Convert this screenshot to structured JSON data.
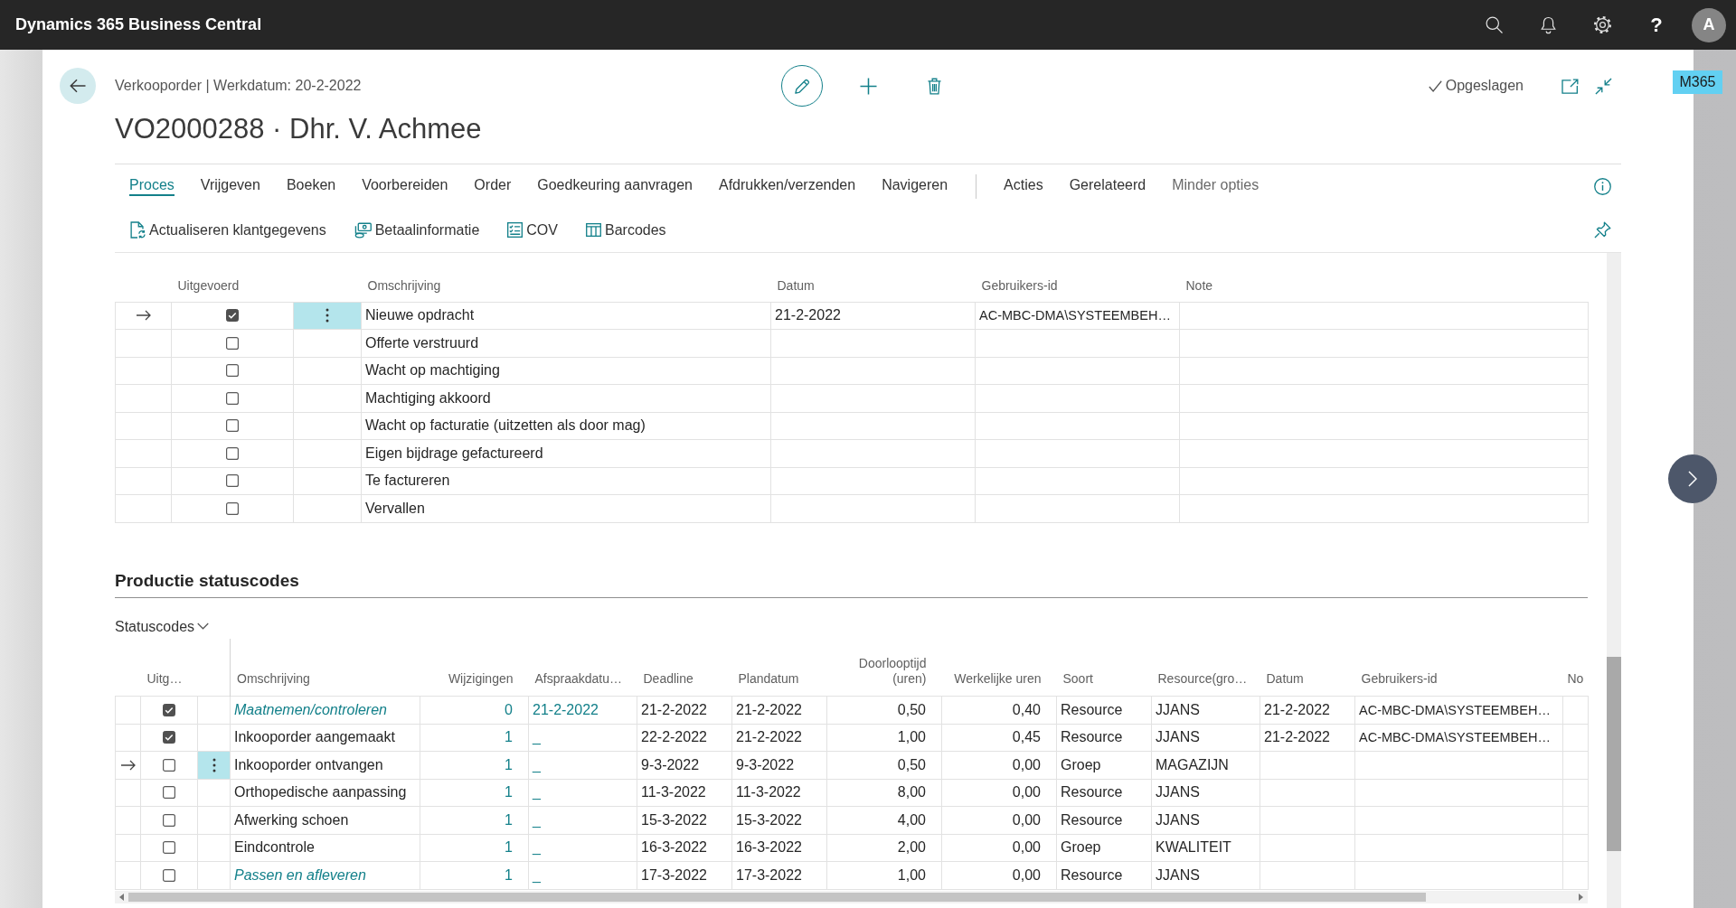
{
  "app_bar": {
    "title": "Dynamics 365 Business Central",
    "help": "?",
    "avatar": "A"
  },
  "environment_badge": "M365",
  "header": {
    "caption": "Verkooporder | Werkdatum: 20-2-2022",
    "title": "VO2000288 · Dhr. V. Achmee",
    "save_status": "Opgeslagen"
  },
  "action_bar": {
    "groups": [
      {
        "tabs": [
          {
            "label": "Proces",
            "selected": true
          },
          {
            "label": "Vrijgeven",
            "selected": false
          },
          {
            "label": "Boeken",
            "selected": false
          },
          {
            "label": "Voorbereiden",
            "selected": false
          },
          {
            "label": "Order",
            "selected": false
          },
          {
            "label": "Goedkeuring aanvragen",
            "selected": false
          },
          {
            "label": "Afdrukken/verzenden",
            "selected": false
          },
          {
            "label": "Navigeren",
            "selected": false
          }
        ]
      },
      {
        "tabs": [
          {
            "label": "Acties",
            "selected": false
          },
          {
            "label": "Gerelateerd",
            "selected": false
          }
        ]
      }
    ],
    "less_options": "Minder opties",
    "actions": [
      {
        "kind": "refresh",
        "label": "Actualiseren klantgegevens"
      },
      {
        "kind": "payment",
        "label": "Betaalinformatie"
      },
      {
        "kind": "checklist",
        "label": "COV"
      },
      {
        "kind": "columns",
        "label": "Barcodes"
      }
    ]
  },
  "process_lines": {
    "columns": [
      "Uitgevoerd",
      "Omschrijving",
      "Datum",
      "Gebruikers-id",
      "Note"
    ],
    "rows": [
      {
        "selected": true,
        "checked": true,
        "description": "Nieuwe opdracht",
        "date": "21-2-2022",
        "user_id": "AC-MBC-DMA\\SYSTEEMBEH…"
      },
      {
        "selected": false,
        "checked": false,
        "description": "Offerte verstruurd"
      },
      {
        "selected": false,
        "checked": false,
        "description": "Wacht op machtiging"
      },
      {
        "selected": false,
        "checked": false,
        "description": "Machtiging akkoord"
      },
      {
        "selected": false,
        "checked": false,
        "description": "Wacht op facturatie (uitzetten als door mag)"
      },
      {
        "selected": false,
        "checked": false,
        "description": "Eigen bijdrage gefactureerd"
      },
      {
        "selected": false,
        "checked": false,
        "description": "Te factureren"
      },
      {
        "selected": false,
        "checked": false,
        "description": "Vervallen"
      }
    ]
  },
  "production_status": {
    "title": "Productie statuscodes",
    "menu_label": "Statuscodes",
    "columns": [
      "Uitg…",
      "Omschrijving",
      "Wijzigingen",
      "Afspraakdatu…",
      "Deadline",
      "Plandatum",
      "Doorlooptijd (uren)",
      "Werkelijke uren",
      "Soort",
      "Resource(gro…",
      "Datum",
      "Gebruikers-id",
      "No"
    ],
    "rows": [
      {
        "selected": false,
        "checked": true,
        "accent": true,
        "description": "Maatnemen/controleren",
        "changes": "0",
        "appointment_date": "21-2-2022",
        "deadline": "21-2-2022",
        "plan_date": "21-2-2022",
        "lead_time": "0,50",
        "actual_hours": "0,40",
        "type": "Resource",
        "resource": "JJANS",
        "date": "21-2-2022",
        "user_id": "AC-MBC-DMA\\SYSTEEMBEH…"
      },
      {
        "selected": false,
        "checked": true,
        "accent": false,
        "description": "Inkooporder aangemaakt",
        "changes": "1",
        "appointment_date": "_",
        "deadline": "22-2-2022",
        "plan_date": "21-2-2022",
        "lead_time": "1,00",
        "actual_hours": "0,45",
        "type": "Resource",
        "resource": "JJANS",
        "date": "21-2-2022",
        "user_id": "AC-MBC-DMA\\SYSTEEMBEH…"
      },
      {
        "selected": true,
        "checked": false,
        "accent": false,
        "description": "Inkooporder ontvangen",
        "changes": "1",
        "appointment_date": "_",
        "deadline": "9-3-2022",
        "plan_date": "9-3-2022",
        "lead_time": "0,50",
        "actual_hours": "0,00",
        "type": "Groep",
        "resource": "MAGAZIJN"
      },
      {
        "selected": false,
        "checked": false,
        "accent": false,
        "description": "Orthopedische aanpassing",
        "changes": "1",
        "appointment_date": "_",
        "deadline": "11-3-2022",
        "plan_date": "11-3-2022",
        "lead_time": "8,00",
        "actual_hours": "0,00",
        "type": "Resource",
        "resource": "JJANS"
      },
      {
        "selected": false,
        "checked": false,
        "accent": false,
        "description": "Afwerking schoen",
        "changes": "1",
        "appointment_date": "_",
        "deadline": "15-3-2022",
        "plan_date": "15-3-2022",
        "lead_time": "4,00",
        "actual_hours": "0,00",
        "type": "Resource",
        "resource": "JJANS"
      },
      {
        "selected": false,
        "checked": false,
        "accent": false,
        "description": "Eindcontrole",
        "changes": "1",
        "appointment_date": "_",
        "deadline": "16-3-2022",
        "plan_date": "16-3-2022",
        "lead_time": "2,00",
        "actual_hours": "0,00",
        "type": "Groep",
        "resource": "KWALITEIT"
      },
      {
        "selected": false,
        "checked": false,
        "accent": true,
        "description": "Passen en afleveren",
        "changes": "1",
        "appointment_date": "_",
        "deadline": "17-3-2022",
        "plan_date": "17-3-2022",
        "lead_time": "1,00",
        "actual_hours": "0,00",
        "type": "Resource",
        "resource": "JJANS"
      }
    ]
  }
}
